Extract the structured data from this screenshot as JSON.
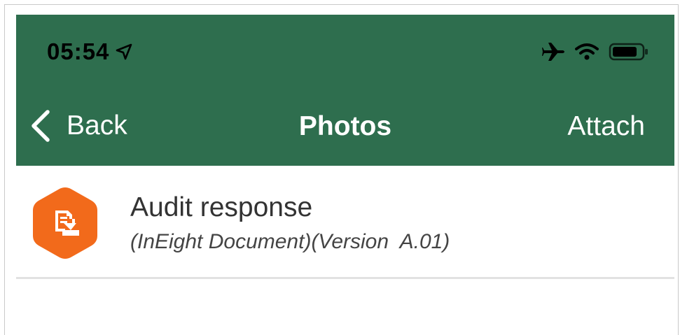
{
  "status_bar": {
    "time": "05:54",
    "icons": [
      "location-arrow-icon",
      "airplane-icon",
      "wifi-icon",
      "battery-icon"
    ]
  },
  "nav": {
    "back_label": "Back",
    "title": "Photos",
    "attach_label": "Attach"
  },
  "list": {
    "items": [
      {
        "title": "Audit response",
        "subtitle": "(InEight Document)(Version  A.01)",
        "icon": "document-icon"
      }
    ]
  },
  "colors": {
    "header_bg": "#2e6e4e",
    "icon_orange": "#f26a1b"
  }
}
